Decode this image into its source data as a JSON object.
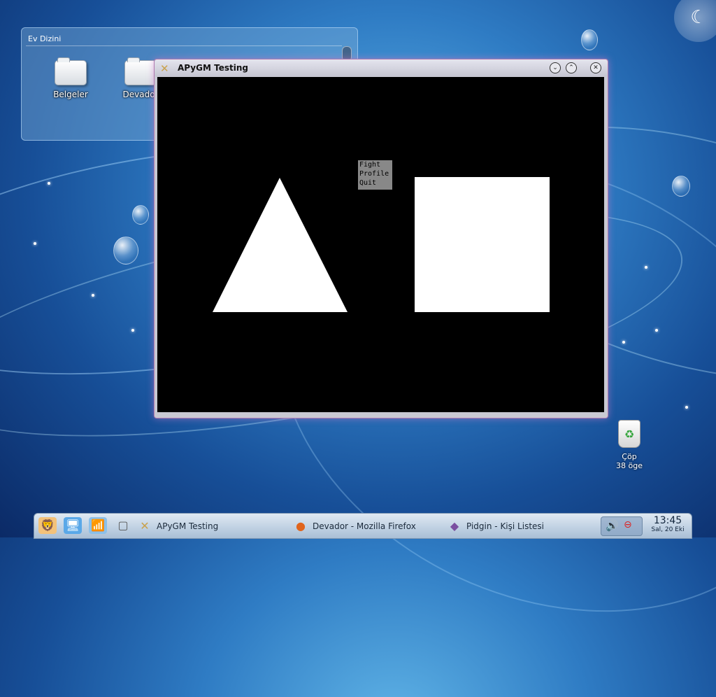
{
  "folder_view": {
    "title": "Ev Dizini",
    "items": [
      {
        "label": "Belgeler",
        "icon": "folder-icon"
      },
      {
        "label": "Devador",
        "icon": "folder-icon"
      }
    ]
  },
  "window": {
    "title": "APyGM Testing",
    "app_icon": "x-app-icon",
    "menu": [
      "Fight",
      "Profile",
      "Quit"
    ]
  },
  "desktop": {
    "trash_label": "Çöp",
    "trash_count": "38 öge"
  },
  "taskbar": {
    "tasks": [
      {
        "label": "APyGM Testing",
        "icon": "x-app-icon"
      },
      {
        "label": "Devador - Mozilla Firefox",
        "icon": "firefox-icon"
      },
      {
        "label": "Pidgin - Kişi Listesi",
        "icon": "pidgin-icon"
      }
    ],
    "clock_time": "13:45",
    "clock_date": "Sal, 20 Eki"
  },
  "colors": {
    "game_background": "#000000",
    "menu_background": "#888888",
    "shape_fill": "#ffffff"
  }
}
